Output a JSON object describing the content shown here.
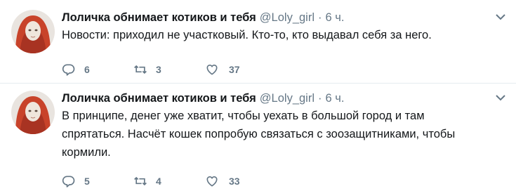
{
  "tweets": [
    {
      "name": "Лоличка обнимает котиков и тебя",
      "handle": "@Loly_girl",
      "separator": "·",
      "time": "6 ч.",
      "text": "Новости: приходил не участковый. Кто-то, кто выдавал себя за него.",
      "replies": "6",
      "retweets": "3",
      "likes": "37"
    },
    {
      "name": "Лоличка обнимает котиков и тебя",
      "handle": "@Loly_girl",
      "separator": "·",
      "time": "6 ч.",
      "text_lines": [
        "В принципе, денег уже хватит, чтобы уехать в большой город и там",
        "спрятаться. Насчёт кошек попробую связаться с зоозащитниками, чтобы",
        "кормили."
      ],
      "replies": "5",
      "retweets": "4",
      "likes": "33"
    }
  ],
  "colors": {
    "text": "#14171a",
    "muted": "#657786",
    "divider": "#e6ecf0",
    "avatar_hood": "#c8432a"
  },
  "icons": [
    "reply-icon",
    "retweet-icon",
    "like-icon",
    "chevron-down-icon"
  ]
}
